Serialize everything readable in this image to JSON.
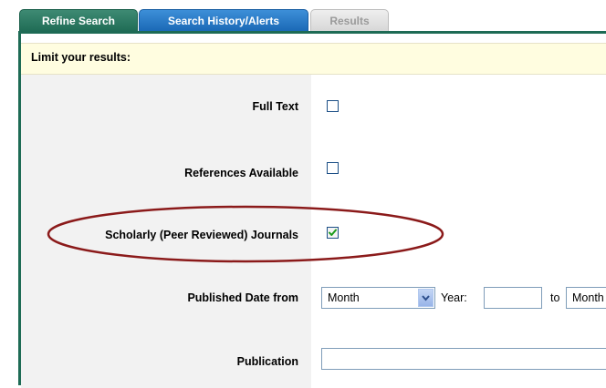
{
  "tabs": [
    {
      "label": "Refine Search",
      "active": true
    },
    {
      "label": "Search History/Alerts",
      "active": false
    },
    {
      "label": "Results",
      "active": false,
      "disabled": true
    }
  ],
  "limit_header": "Limit your results:",
  "fields": {
    "full_text": {
      "label": "Full Text",
      "checked": false
    },
    "references": {
      "label": "References Available",
      "checked": false
    },
    "scholarly": {
      "label": "Scholarly (Peer Reviewed) Journals",
      "checked": true
    },
    "published_date": {
      "label": "Published Date from",
      "from_month": "Month",
      "year_label": "Year:",
      "year_value": "",
      "to_label": "to",
      "to_month": "Month"
    },
    "publication": {
      "label": "Publication",
      "value": ""
    }
  },
  "colors": {
    "refine_tab": "#2b7a62",
    "history_tab": "#2a7bc7",
    "header_bg": "#fffde0",
    "ellipse": "#8b1a1a",
    "checkmark": "#1a9b1a"
  }
}
